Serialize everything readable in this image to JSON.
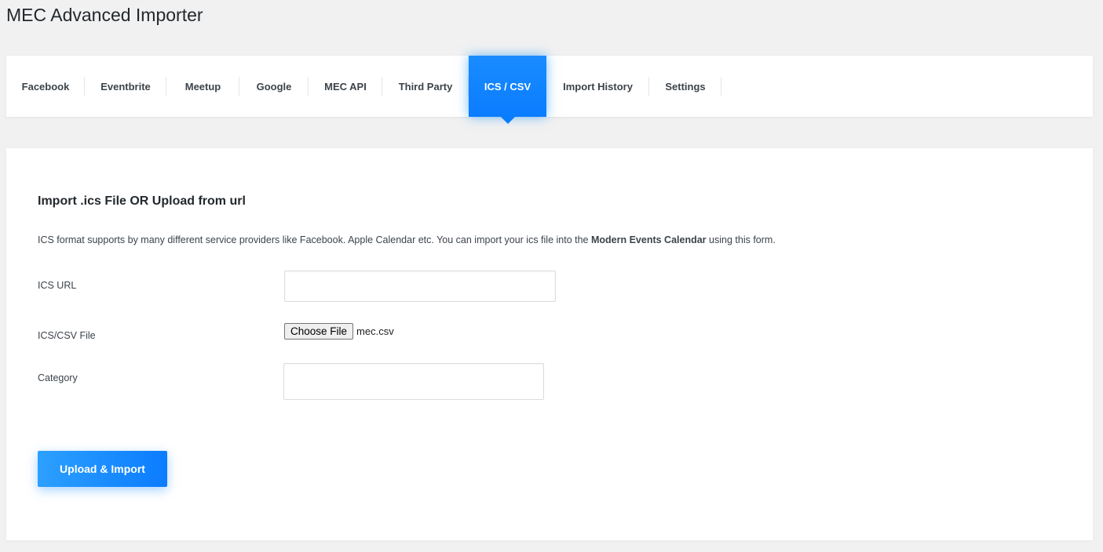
{
  "app": {
    "title": "MEC Advanced Importer"
  },
  "tabs": [
    {
      "label": "Facebook",
      "active": false
    },
    {
      "label": "Eventbrite",
      "active": false
    },
    {
      "label": "Meetup",
      "active": false
    },
    {
      "label": "Google",
      "active": false
    },
    {
      "label": "MEC API",
      "active": false
    },
    {
      "label": "Third Party",
      "active": false
    },
    {
      "label": "ICS / CSV",
      "active": true
    },
    {
      "label": "Import History",
      "active": false
    },
    {
      "label": "Settings",
      "active": false
    }
  ],
  "panel": {
    "title": "Import .ics File OR Upload from url",
    "description_prefix": "ICS format supports by many different service providers like Facebook. Apple Calendar etc. You can import your ics file into the ",
    "description_bold": "Modern Events Calendar",
    "description_suffix": " using this form.",
    "fields": {
      "ics_url": {
        "label": "ICS URL",
        "value": "",
        "placeholder": ""
      },
      "file": {
        "label": "ICS/CSV File",
        "button_label": "Choose File",
        "file_name": "mec.csv"
      },
      "category": {
        "label": "Category",
        "value": "",
        "placeholder": ""
      }
    },
    "submit_label": "Upload & Import"
  },
  "colors": {
    "accent": "#0a7cff",
    "background": "#f1f1f1",
    "panel": "#ffffff"
  }
}
